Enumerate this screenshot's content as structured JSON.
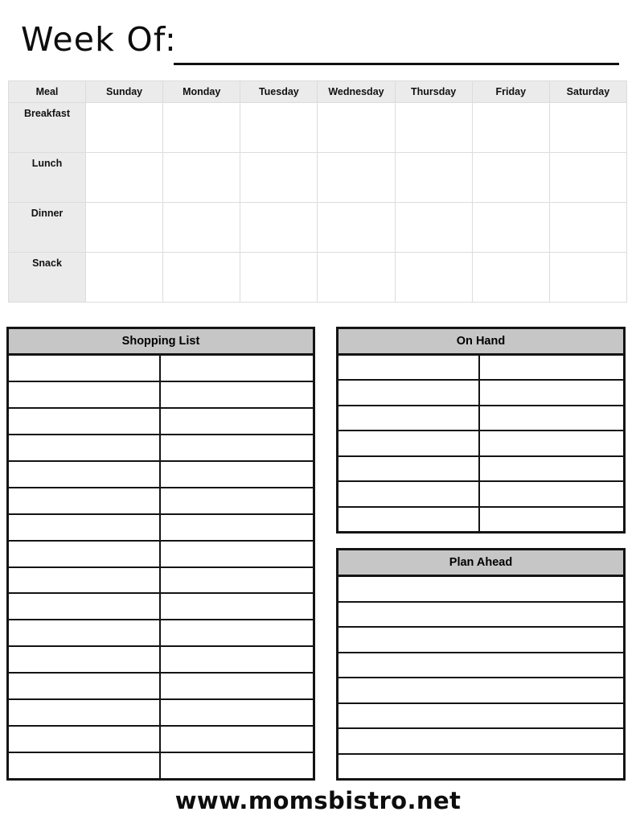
{
  "page": {
    "title": "Week Of:",
    "footer_url": "www.momsbistro.net",
    "colors": {
      "grid_header_bg": "#ebebeb",
      "list_header_bg": "#c6c6c6",
      "border_dark": "#141414",
      "border_light": "#dcdcdc",
      "text": "#000000",
      "page_bg": "#ffffff"
    }
  },
  "week_grid": {
    "columns": [
      "Meal",
      "Sunday",
      "Monday",
      "Tuesday",
      "Wednesday",
      "Thursday",
      "Friday",
      "Saturday"
    ],
    "rows": [
      {
        "label": "Breakfast",
        "cells": [
          "",
          "",
          "",
          "",
          "",
          "",
          ""
        ]
      },
      {
        "label": "Lunch",
        "cells": [
          "",
          "",
          "",
          "",
          "",
          "",
          ""
        ]
      },
      {
        "label": "Dinner",
        "cells": [
          "",
          "",
          "",
          "",
          "",
          "",
          ""
        ]
      },
      {
        "label": "Snack",
        "cells": [
          "",
          "",
          "",
          "",
          "",
          "",
          ""
        ]
      }
    ]
  },
  "shopping_list": {
    "heading": "Shopping List",
    "column_count": 2,
    "row_count": 16,
    "rows": [
      {
        "left": "",
        "right": ""
      },
      {
        "left": "",
        "right": ""
      },
      {
        "left": "",
        "right": ""
      },
      {
        "left": "",
        "right": ""
      },
      {
        "left": "",
        "right": ""
      },
      {
        "left": "",
        "right": ""
      },
      {
        "left": "",
        "right": ""
      },
      {
        "left": "",
        "right": ""
      },
      {
        "left": "",
        "right": ""
      },
      {
        "left": "",
        "right": ""
      },
      {
        "left": "",
        "right": ""
      },
      {
        "left": "",
        "right": ""
      },
      {
        "left": "",
        "right": ""
      },
      {
        "left": "",
        "right": ""
      },
      {
        "left": "",
        "right": ""
      },
      {
        "left": "",
        "right": ""
      }
    ]
  },
  "on_hand": {
    "heading": "On Hand",
    "column_count": 2,
    "row_count": 7,
    "rows": [
      {
        "left": "",
        "right": ""
      },
      {
        "left": "",
        "right": ""
      },
      {
        "left": "",
        "right": ""
      },
      {
        "left": "",
        "right": ""
      },
      {
        "left": "",
        "right": ""
      },
      {
        "left": "",
        "right": ""
      },
      {
        "left": "",
        "right": ""
      }
    ]
  },
  "plan_ahead": {
    "heading": "Plan Ahead",
    "column_count": 1,
    "row_count": 8,
    "rows": [
      {
        "value": ""
      },
      {
        "value": ""
      },
      {
        "value": ""
      },
      {
        "value": ""
      },
      {
        "value": ""
      },
      {
        "value": ""
      },
      {
        "value": ""
      },
      {
        "value": ""
      }
    ]
  }
}
